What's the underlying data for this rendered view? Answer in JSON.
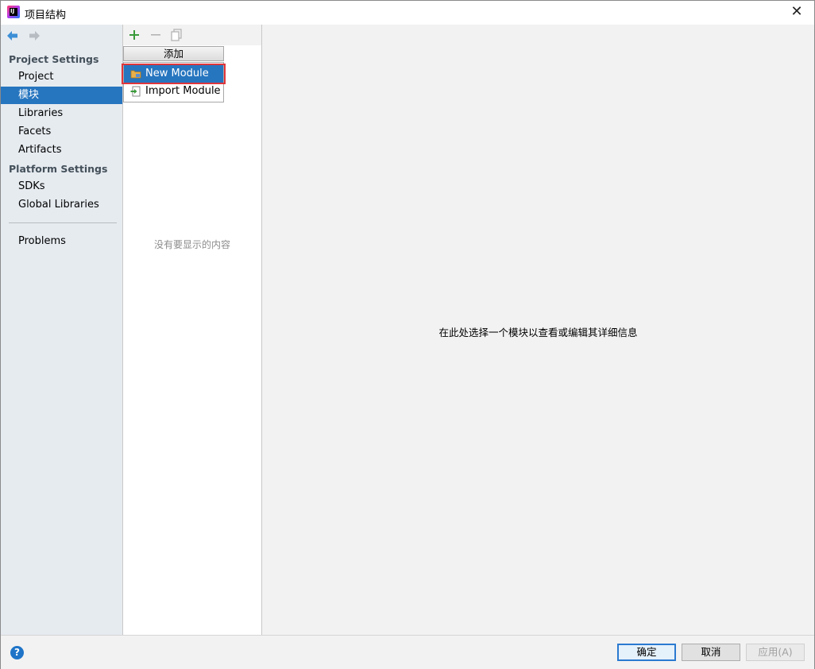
{
  "window": {
    "title": "项目结构",
    "close_glyph": "✕",
    "logo_text": "IJ"
  },
  "sidebar": {
    "project_settings_title": "Project Settings",
    "project_settings_items": [
      {
        "label": "Project",
        "selected": false
      },
      {
        "label": "模块",
        "selected": true
      },
      {
        "label": "Libraries",
        "selected": false
      },
      {
        "label": "Facets",
        "selected": false
      },
      {
        "label": "Artifacts",
        "selected": false
      }
    ],
    "platform_settings_title": "Platform Settings",
    "platform_settings_items": [
      {
        "label": "SDKs"
      },
      {
        "label": "Global Libraries"
      }
    ],
    "problems_label": "Problems"
  },
  "modules": {
    "empty_text": "没有要显示的内容"
  },
  "add_popup": {
    "header": "添加",
    "items": [
      {
        "label": "New Module",
        "icon": "folder-module-icon",
        "highlighted": true
      },
      {
        "label": "Import Module",
        "icon": "import-module-icon",
        "highlighted": false
      }
    ]
  },
  "detail": {
    "hint": "在此处选择一个模块以查看或编辑其详细信息"
  },
  "footer": {
    "help_glyph": "?",
    "ok_label": "确定",
    "cancel_label": "取消",
    "apply_label": "应用(A)"
  },
  "colors": {
    "selection": "#2675bf",
    "highlight_outline": "#e0353b",
    "sidebar_bg": "#e6ebf0",
    "add_icon": "#3a9a3a"
  }
}
